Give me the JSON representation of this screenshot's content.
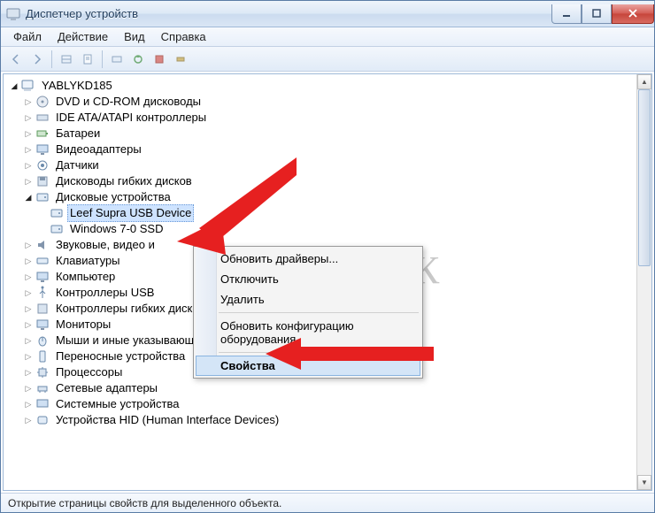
{
  "window": {
    "title": "Диспетчер устройств"
  },
  "menu": {
    "file": "Файл",
    "action": "Действие",
    "view": "Вид",
    "help": "Справка"
  },
  "tree": {
    "root": "YABLYKD185",
    "items": [
      "DVD и CD-ROM дисководы",
      "IDE ATA/ATAPI контроллеры",
      "Батареи",
      "Видеоадаптеры",
      "Датчики",
      "Дисководы гибких дисков",
      "Дисковые устройства",
      "Звуковые, видео и",
      "Клавиатуры",
      "Компьютер",
      "Контроллеры USB",
      "Контроллеры гибких дисков",
      "Мониторы",
      "Мыши и иные указывающие устройства",
      "Переносные устройства",
      "Процессоры",
      "Сетевые адаптеры",
      "Системные устройства",
      "Устройства HID (Human Interface Devices)"
    ],
    "disk_children": [
      "Leef Supra USB Device",
      "Windows 7-0 SSD"
    ]
  },
  "context_menu": {
    "update_drivers": "Обновить драйверы...",
    "disable": "Отключить",
    "remove": "Удалить",
    "refresh_hw": "Обновить конфигурацию оборудования",
    "properties": "Свойства"
  },
  "status": "Открытие страницы свойств для выделенного объекта.",
  "watermark": "ЯБЛЫК"
}
